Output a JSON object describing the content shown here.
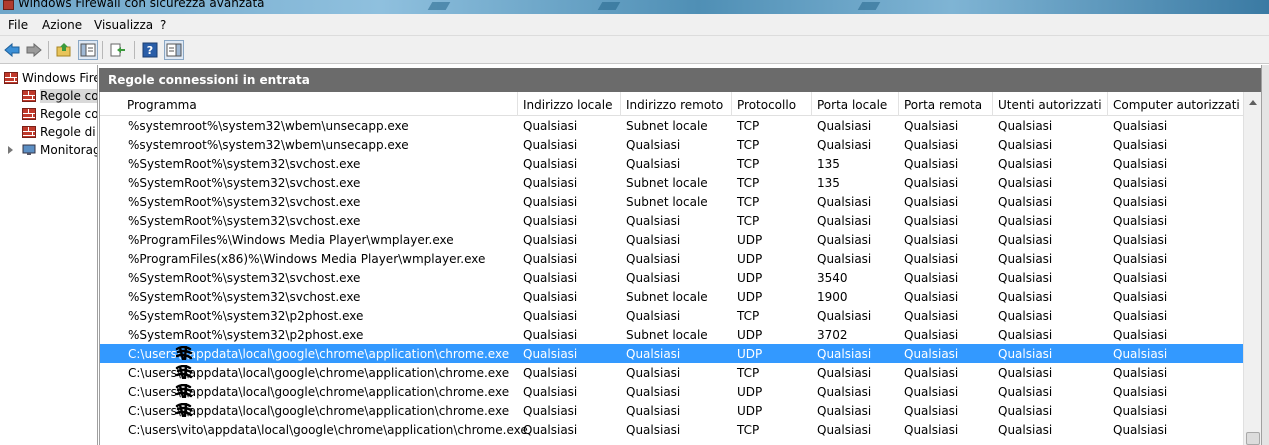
{
  "window": {
    "title": "Windows Firewall con sicurezza avanzata"
  },
  "menu": [
    "File",
    "Azione",
    "Visualizza",
    "?"
  ],
  "toolbar": {
    "buttons": [
      "back-arrow-icon",
      "forward-arrow-icon",
      "up-folder-icon",
      "show-hide-tree-icon",
      "export-list-icon",
      "help-icon",
      "show-hide-action-pane-icon"
    ]
  },
  "sidebar": {
    "items": [
      {
        "label": "Windows Firewall con sicurezza avanzata",
        "icon": "firewall-icon"
      },
      {
        "label": "Regole connessioni in entrata",
        "icon": "firewall-rules-icon"
      },
      {
        "label": "Regole connessioni in uscita",
        "icon": "firewall-rules-icon"
      },
      {
        "label": "Regole di sicurezza connessione",
        "icon": "firewall-rules-icon"
      },
      {
        "label": "Monitoraggio",
        "icon": "monitor-icon"
      }
    ]
  },
  "pane": {
    "title": "Regole connessioni in entrata",
    "columns": [
      "Programma",
      "Indirizzo locale",
      "Indirizzo remoto",
      "Protocollo",
      "Porta locale",
      "Porta remota",
      "Utenti autorizzati",
      "Computer autorizzati"
    ],
    "rows": [
      [
        "%systemroot%\\system32\\wbem\\unsecapp.exe",
        "Qualsiasi",
        "Subnet locale",
        "TCP",
        "Qualsiasi",
        "Qualsiasi",
        "Qualsiasi",
        "Qualsiasi"
      ],
      [
        "%systemroot%\\system32\\wbem\\unsecapp.exe",
        "Qualsiasi",
        "Qualsiasi",
        "TCP",
        "Qualsiasi",
        "Qualsiasi",
        "Qualsiasi",
        "Qualsiasi"
      ],
      [
        "%SystemRoot%\\system32\\svchost.exe",
        "Qualsiasi",
        "Qualsiasi",
        "TCP",
        "135",
        "Qualsiasi",
        "Qualsiasi",
        "Qualsiasi"
      ],
      [
        "%SystemRoot%\\system32\\svchost.exe",
        "Qualsiasi",
        "Subnet locale",
        "TCP",
        "135",
        "Qualsiasi",
        "Qualsiasi",
        "Qualsiasi"
      ],
      [
        "%SystemRoot%\\system32\\svchost.exe",
        "Qualsiasi",
        "Subnet locale",
        "TCP",
        "Qualsiasi",
        "Qualsiasi",
        "Qualsiasi",
        "Qualsiasi"
      ],
      [
        "%SystemRoot%\\system32\\svchost.exe",
        "Qualsiasi",
        "Qualsiasi",
        "TCP",
        "Qualsiasi",
        "Qualsiasi",
        "Qualsiasi",
        "Qualsiasi"
      ],
      [
        "%ProgramFiles%\\Windows Media Player\\wmplayer.exe",
        "Qualsiasi",
        "Qualsiasi",
        "UDP",
        "Qualsiasi",
        "Qualsiasi",
        "Qualsiasi",
        "Qualsiasi"
      ],
      [
        "%ProgramFiles(x86)%\\Windows Media Player\\wmplayer.exe",
        "Qualsiasi",
        "Qualsiasi",
        "UDP",
        "Qualsiasi",
        "Qualsiasi",
        "Qualsiasi",
        "Qualsiasi"
      ],
      [
        "%SystemRoot%\\system32\\svchost.exe",
        "Qualsiasi",
        "Qualsiasi",
        "UDP",
        "3540",
        "Qualsiasi",
        "Qualsiasi",
        "Qualsiasi"
      ],
      [
        "%SystemRoot%\\system32\\svchost.exe",
        "Qualsiasi",
        "Subnet locale",
        "UDP",
        "1900",
        "Qualsiasi",
        "Qualsiasi",
        "Qualsiasi"
      ],
      [
        "%SystemRoot%\\system32\\p2phost.exe",
        "Qualsiasi",
        "Qualsiasi",
        "TCP",
        "Qualsiasi",
        "Qualsiasi",
        "Qualsiasi",
        "Qualsiasi"
      ],
      [
        "%SystemRoot%\\system32\\p2phost.exe",
        "Qualsiasi",
        "Subnet locale",
        "UDP",
        "3702",
        "Qualsiasi",
        "Qualsiasi",
        "Qualsiasi"
      ],
      [
        "C:\\users\\      \\appdata\\local\\google\\chrome\\application\\chrome.exe",
        "Qualsiasi",
        "Qualsiasi",
        "UDP",
        "Qualsiasi",
        "Qualsiasi",
        "Qualsiasi",
        "Qualsiasi"
      ],
      [
        "C:\\users\\      \\appdata\\local\\google\\chrome\\application\\chrome.exe",
        "Qualsiasi",
        "Qualsiasi",
        "TCP",
        "Qualsiasi",
        "Qualsiasi",
        "Qualsiasi",
        "Qualsiasi"
      ],
      [
        "C:\\users\\      \\appdata\\local\\google\\chrome\\application\\chrome.exe",
        "Qualsiasi",
        "Qualsiasi",
        "UDP",
        "Qualsiasi",
        "Qualsiasi",
        "Qualsiasi",
        "Qualsiasi"
      ],
      [
        "C:\\users\\      \\appdata\\local\\google\\chrome\\application\\chrome.exe",
        "Qualsiasi",
        "Qualsiasi",
        "UDP",
        "Qualsiasi",
        "Qualsiasi",
        "Qualsiasi",
        "Qualsiasi"
      ],
      [
        "C:\\users\\vito\\appdata\\local\\google\\chrome\\application\\chrome.exe",
        "Qualsiasi",
        "Qualsiasi",
        "TCP",
        "Qualsiasi",
        "Qualsiasi",
        "Qualsiasi",
        "Qualsiasi"
      ]
    ],
    "selected_row": 12
  },
  "colors": {
    "selection": "#3399ff",
    "header_bar": "#6b6b6b"
  }
}
